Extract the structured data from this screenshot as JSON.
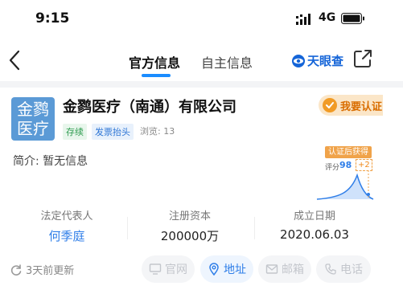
{
  "status_bar": {
    "time": "9:15",
    "network": "4G",
    "icons": [
      "signal-icon",
      "battery-icon"
    ]
  },
  "nav": {
    "tabs": [
      {
        "label": "官方信息",
        "active": true
      },
      {
        "label": "自主信息",
        "active": false
      }
    ],
    "brand": "天眼查",
    "icons": [
      "back-icon",
      "share-icon"
    ]
  },
  "company": {
    "logo_text": [
      "金鹨",
      "医疗"
    ],
    "name": "金鹨医疗（南通）有限公司",
    "tags": [
      "存续",
      "发票抬头"
    ],
    "views_label": "浏览:",
    "views_count": "13",
    "verify_label": "我要认证",
    "intro_label": "简介:",
    "intro_value": "暂无信息"
  },
  "promo": {
    "title": "认证后获得",
    "score_label": "评分",
    "score": "98",
    "bonus": "+2"
  },
  "stats": {
    "legal_rep_label": "法定代表人",
    "legal_rep_value": "何季庭",
    "capital_label": "注册资本",
    "capital_value": "200000万",
    "founded_label": "成立日期",
    "founded_value": "2020.06.03"
  },
  "footer": {
    "update_text": "3天前更新",
    "actions": {
      "website": "官网",
      "address": "地址",
      "email": "邮箱",
      "phone": "电话"
    }
  },
  "colors": {
    "accent": "#1a8cff",
    "logo_bg": "#5b9ad6",
    "verify_bg": "#fbe6c8",
    "verify_text": "#d96d00",
    "status_green": "#2d9b4e"
  }
}
